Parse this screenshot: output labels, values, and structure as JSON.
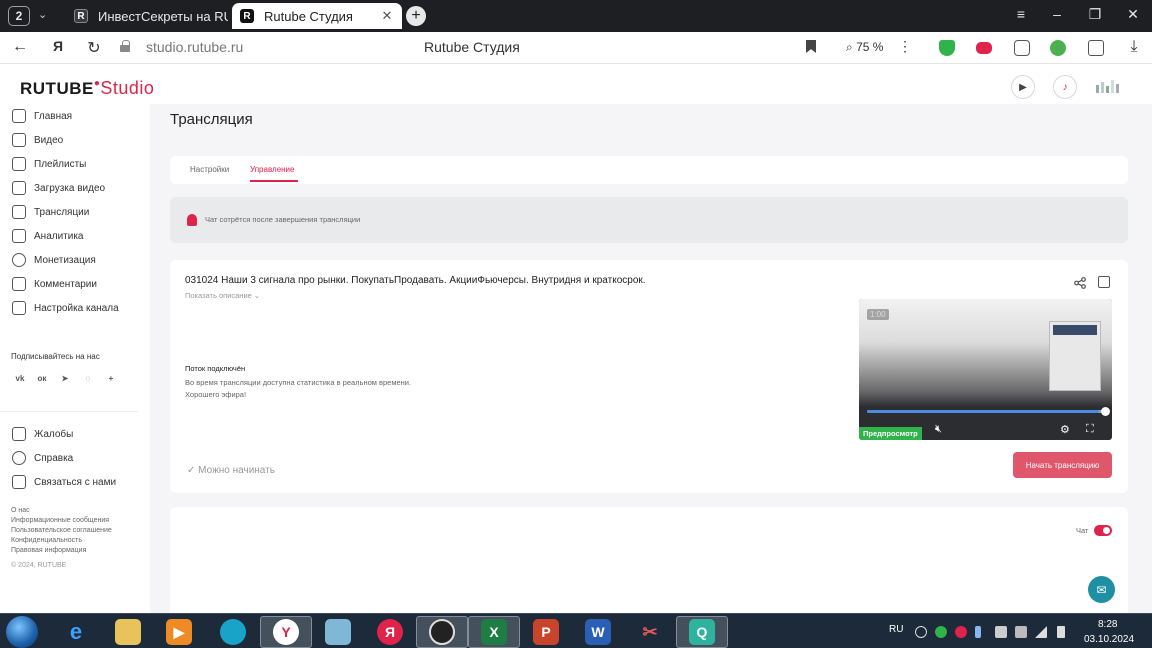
{
  "browser": {
    "tab_count": "2",
    "tabs": [
      {
        "title": "ИнвестСекреты на RUTUBE",
        "favicon": "R"
      },
      {
        "title": "Rutube Студия",
        "favicon": "R"
      }
    ],
    "url_domain": "studio.rutube.ru",
    "page_title": "Rutube Студия",
    "zoom": "75 %"
  },
  "header": {
    "logo_main": "RUTUBE",
    "logo_studio": "Studio"
  },
  "sidebar": {
    "items": [
      {
        "label": "Главная",
        "icon": "home-icon"
      },
      {
        "label": "Видео",
        "icon": "video-icon"
      },
      {
        "label": "Плейлисты",
        "icon": "playlist-icon"
      },
      {
        "label": "Загрузка видео",
        "icon": "upload-icon"
      },
      {
        "label": "Трансляции",
        "icon": "broadcast-icon"
      },
      {
        "label": "Аналитика",
        "icon": "analytics-icon"
      },
      {
        "label": "Монетизация",
        "icon": "monetization-icon"
      },
      {
        "label": "Комментарии",
        "icon": "comments-icon"
      },
      {
        "label": "Настройка канала",
        "icon": "settings-icon"
      }
    ],
    "subscribe_label": "Подписывайтесь на нас",
    "socials": [
      "vk-icon",
      "ok-icon",
      "telegram-icon",
      "viber-icon",
      "more-icon"
    ],
    "secondary": [
      {
        "label": "Жалобы",
        "icon": "flag-icon"
      },
      {
        "label": "Справка",
        "icon": "help-icon"
      },
      {
        "label": "Связаться с нами",
        "icon": "contact-icon"
      }
    ],
    "footer_links": [
      "О нас",
      "Информационные сообщения",
      "Пользовательское соглашение",
      "Конфиденциальность",
      "Правовая информация"
    ],
    "copyright": "© 2024, RUTUBE"
  },
  "main": {
    "title": "Трансляция",
    "tabs": [
      "Настройки",
      "Управление"
    ],
    "active_tab": 1,
    "notice": "Чат сотрётся после завершения трансляции",
    "stream": {
      "title": "031024 Наши 3 сигнала про рынки. ПокупатьПродавать. АкцииФьючерсы. Внутридня и краткосрок.",
      "show_description": "Показать описание",
      "status_title": "Поток подключён",
      "status_lines": [
        "Во время трансляции доступна статистика в реальном времени.",
        "Хорошего эфира!"
      ],
      "ready_text": "Можно начинать",
      "preview_badge": "Предпросмотр",
      "preview_time": "1:00",
      "preview_progress": 0.98,
      "start_button": "Начать трансляцию"
    },
    "chat": {
      "label": "Чат",
      "enabled": true
    }
  },
  "taskbar": {
    "apps": [
      "ie-icon",
      "explorer-icon",
      "media-player-icon",
      "edge-icon",
      "yandex-browser-icon",
      "notepad-icon",
      "yandex-icon",
      "obs-icon",
      "excel-icon",
      "powerpoint-icon",
      "word-icon",
      "snipping-icon",
      "q-app-icon"
    ],
    "active_app": 4,
    "lang": "RU",
    "time": "8:28",
    "date": "03.10.2024"
  },
  "colors": {
    "accent": "#e0234a",
    "start_button": "#e0566b",
    "preview_badge": "#2fb34a",
    "taskbar": "#1d2a3a"
  }
}
